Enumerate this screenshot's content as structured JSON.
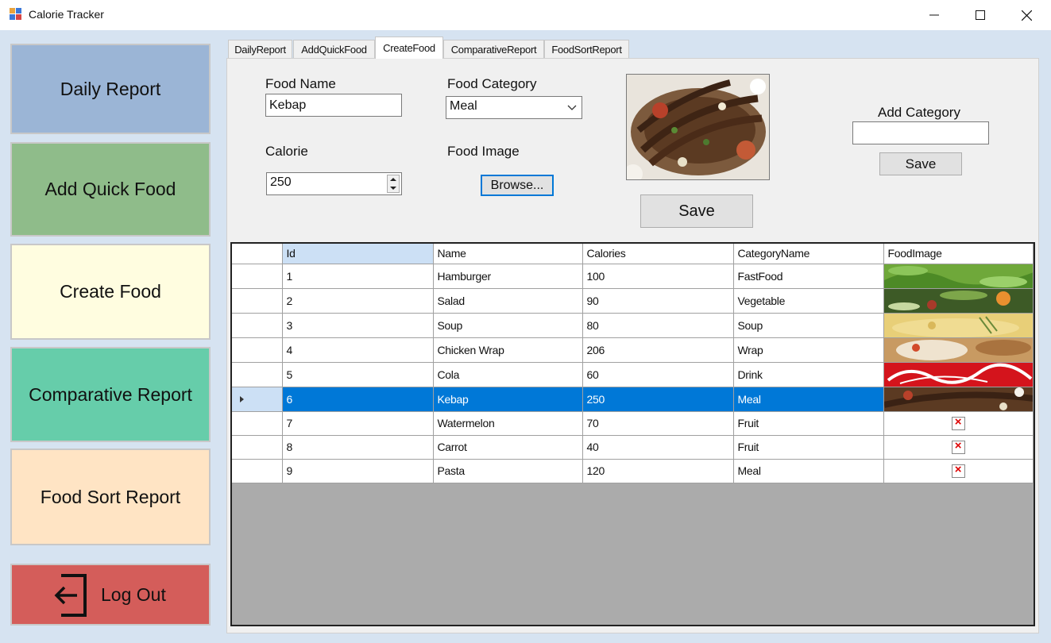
{
  "window": {
    "title": "Calorie Tracker",
    "controls": [
      "minimize",
      "maximize",
      "close"
    ]
  },
  "sidebar": {
    "items": [
      {
        "label": "Daily Report",
        "color": "#9bb5d6"
      },
      {
        "label": "Add Quick Food",
        "color": "#8fbc8a"
      },
      {
        "label": "Create Food",
        "color": "#fffde0"
      },
      {
        "label": "Comparative Report",
        "color": "#66cdaa"
      },
      {
        "label": "Food Sort Report",
        "color": "#ffe4c4"
      }
    ],
    "logout": {
      "label": "Log Out",
      "icon": "logout-icon",
      "color": "#d45d5a"
    }
  },
  "tabs": {
    "items": [
      "DailyReport",
      "AddQuickFood",
      "CreateFood",
      "ComparativeReport",
      "FoodSortReport"
    ],
    "active": "CreateFood"
  },
  "form": {
    "food_name_label": "Food Name",
    "food_name_value": "Kebap",
    "food_category_label": "Food Category",
    "food_category_value": "Meal",
    "calorie_label": "Calorie",
    "calorie_value": "250",
    "food_image_label": "Food Image",
    "browse_label": "Browse...",
    "save_label": "Save",
    "add_category_label": "Add Category",
    "add_category_value": "",
    "add_category_save_label": "Save",
    "preview_image": "kebab-platter-photo"
  },
  "grid": {
    "columns": [
      "Id",
      "Name",
      "Calories",
      "CategoryName",
      "FoodImage"
    ],
    "sorted_column": "Id",
    "selected_row_id": "6",
    "rows": [
      {
        "id": "1",
        "name": "Hamburger",
        "calories": "100",
        "category": "FastFood",
        "image": "lettuce-photo"
      },
      {
        "id": "2",
        "name": "Salad",
        "calories": "90",
        "category": "Vegetable",
        "image": "salad-photo"
      },
      {
        "id": "3",
        "name": "Soup",
        "calories": "80",
        "category": "Soup",
        "image": "soup-photo"
      },
      {
        "id": "4",
        "name": "Chicken Wrap",
        "calories": "206",
        "category": "Wrap",
        "image": "wrap-photo"
      },
      {
        "id": "5",
        "name": "Cola",
        "calories": "60",
        "category": "Drink",
        "image": "cola-logo-photo"
      },
      {
        "id": "6",
        "name": "Kebap",
        "calories": "250",
        "category": "Meal",
        "image": "kebab-photo"
      },
      {
        "id": "7",
        "name": "Watermelon",
        "calories": "70",
        "category": "Fruit",
        "image": "broken-image-icon"
      },
      {
        "id": "8",
        "name": "Carrot",
        "calories": "40",
        "category": "Fruit",
        "image": "broken-image-icon"
      },
      {
        "id": "9",
        "name": "Pasta",
        "calories": "120",
        "category": "Meal",
        "image": "broken-image-icon"
      }
    ]
  }
}
